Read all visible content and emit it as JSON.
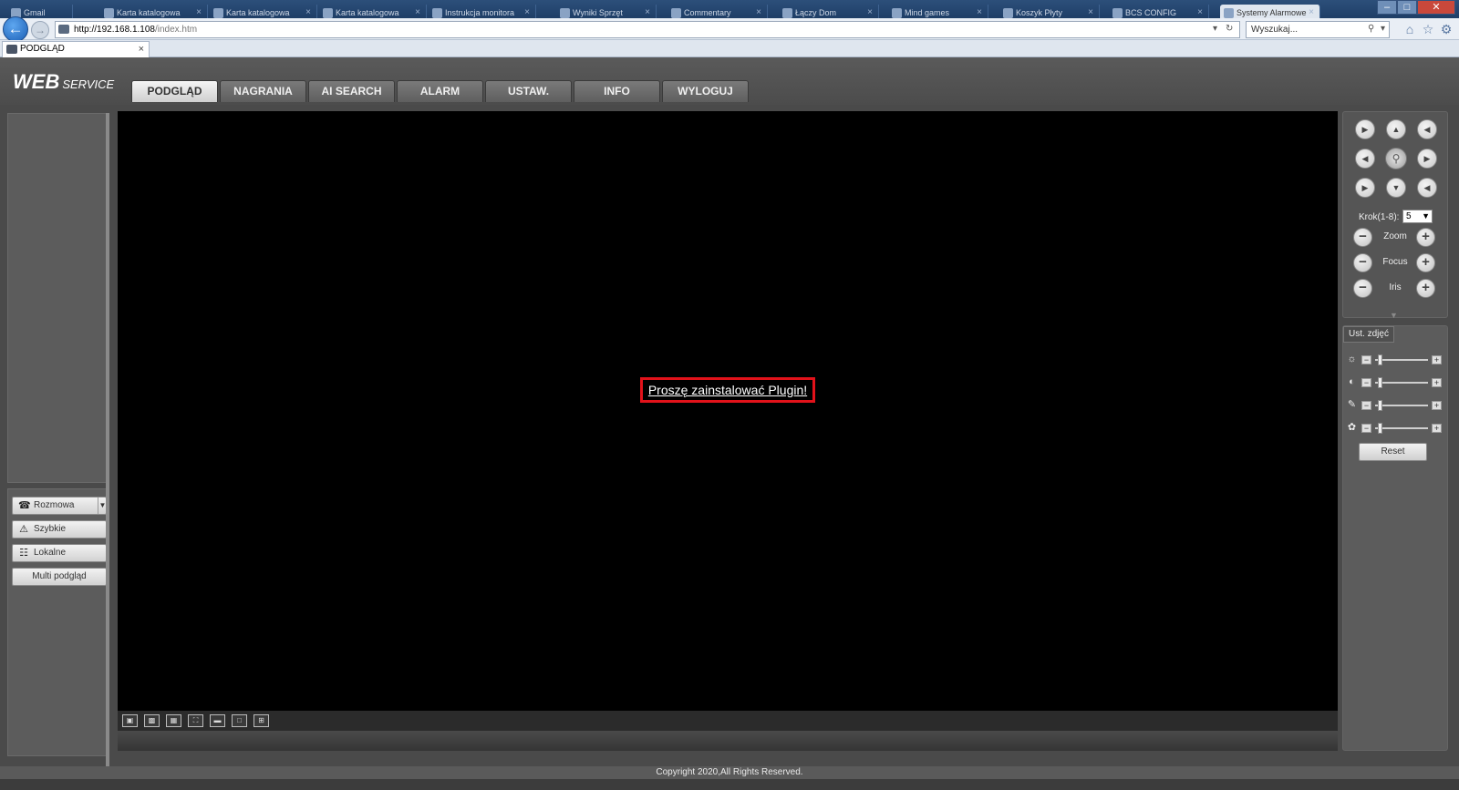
{
  "browser": {
    "tabs": [
      {
        "label": "Gmail"
      },
      {
        "label": "Karta katalogowa"
      },
      {
        "label": "Karta katalogowa"
      },
      {
        "label": "Karta katalogowa"
      },
      {
        "label": "Instrukcja monitora"
      },
      {
        "label": "Wyniki Sprzęt"
      },
      {
        "label": "Commentary"
      },
      {
        "label": "Łączy Dom"
      },
      {
        "label": "Mind games"
      },
      {
        "label": "Koszyk Płyty"
      },
      {
        "label": "BCS CONFIG"
      },
      {
        "label": "Systemy Alarmowe"
      }
    ],
    "url_host": "http://192.168.1.108",
    "url_path": "/index.htm",
    "search_placeholder": "Wyszukaj...",
    "page_tab_title": "PODGLĄD",
    "close_glyph": "×"
  },
  "app": {
    "logo_main": "WEB",
    "logo_sub": "SERVICE",
    "nav": [
      "PODGLĄD",
      "NAGRANIA",
      "AI SEARCH",
      "ALARM",
      "USTAW.",
      "INFO",
      "WYLOGUJ"
    ],
    "active_nav": "PODGLĄD"
  },
  "left_panel": {
    "buttons": [
      {
        "label": "Rozmowa",
        "icon": "phone-icon"
      },
      {
        "label": "Szybkie",
        "icon": "warning-icon"
      },
      {
        "label": "Lokalne",
        "icon": "film-icon"
      },
      {
        "label": "Multi podgląd"
      }
    ]
  },
  "video": {
    "plugin_message": "Proszę zainstalować Plugin!",
    "toolbar_icons": [
      "original-size-icon",
      "fit-window-icon",
      "smart-icon",
      "fullscreen-icon",
      "stretch-icon",
      "single-view-icon",
      "four-split-icon"
    ]
  },
  "ptz": {
    "step_label": "Krok(1-8):",
    "step_value": "5",
    "controls": [
      {
        "label": "Zoom"
      },
      {
        "label": "Focus"
      },
      {
        "label": "Iris"
      }
    ]
  },
  "image_settings": {
    "tab_label": "Ust. zdjęć",
    "rows": [
      {
        "icon": "brightness-icon",
        "value": 0.05
      },
      {
        "icon": "contrast-icon",
        "value": 0.05
      },
      {
        "icon": "saturation-icon",
        "value": 0.05
      },
      {
        "icon": "hue-icon",
        "value": 0.05
      }
    ],
    "reset_label": "Reset"
  },
  "footer": {
    "copyright": "Copyright 2020,All Rights Reserved."
  },
  "colors": {
    "alert_border": "#e2121a",
    "video_bg": "#000000",
    "app_bg": "#4a4a4a"
  }
}
